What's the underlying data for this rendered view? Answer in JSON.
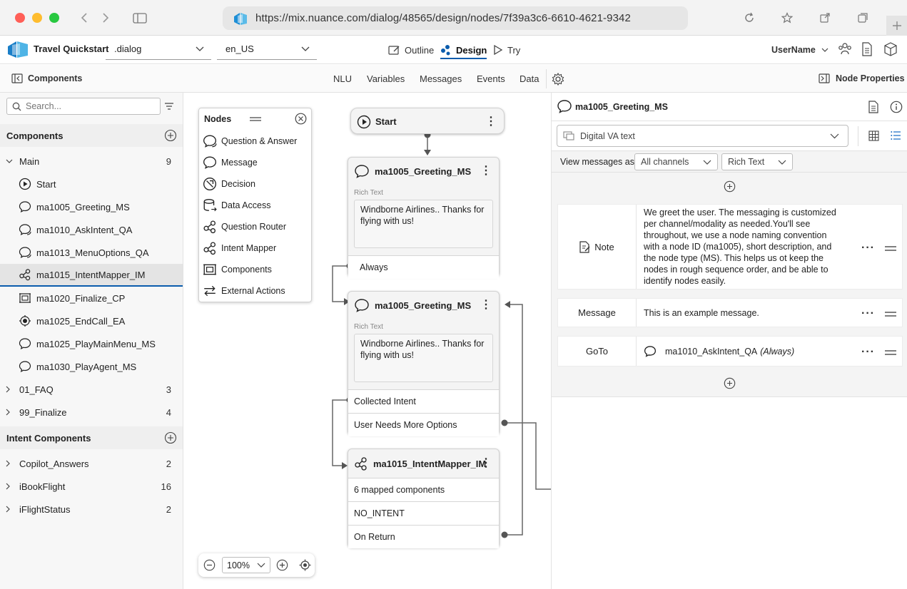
{
  "browser": {
    "url": "https://mix.nuance.com/dialog/48565/design/nodes/7f39a3c6-6610-4621-9342",
    "colors": {
      "close": "#ff5f57",
      "minimize": "#febc2e",
      "maximize": "#28c840"
    }
  },
  "app": {
    "title": "Travel Quickstart",
    "dialog_select": ".dialog",
    "locale_select": "en_US",
    "tabs": [
      {
        "label": "Outline",
        "icon": "outline-icon"
      },
      {
        "label": "Design",
        "icon": "design-icon",
        "active": true
      },
      {
        "label": "Try",
        "icon": "play-icon"
      }
    ],
    "user": "UserName",
    "accent": "#0b5cad"
  },
  "toolbar": {
    "components_label": "Components",
    "tabs": [
      "NLU",
      "Variables",
      "Messages",
      "Events",
      "Data"
    ],
    "node_properties_label": "Node Properties"
  },
  "sidebar": {
    "search_placeholder": "Search...",
    "components_header": "Components",
    "main": {
      "label": "Main",
      "count": "9"
    },
    "main_items": [
      {
        "label": "Start",
        "icon": "start-icon"
      },
      {
        "label": "ma1005_Greeting_MS",
        "icon": "message-icon"
      },
      {
        "label": "ma1010_AskIntent_QA",
        "icon": "question-icon"
      },
      {
        "label": "ma1013_MenuOptions_QA",
        "icon": "question-icon"
      },
      {
        "label": "ma1015_IntentMapper_IM",
        "icon": "intent-mapper-icon",
        "selected": true
      },
      {
        "label": "ma1020_Finalize_CP",
        "icon": "component-icon"
      },
      {
        "label": "ma1025_EndCall_EA",
        "icon": "external-action-icon"
      },
      {
        "label": "ma1025_PlayMainMenu_MS",
        "icon": "message-icon"
      },
      {
        "label": "ma1030_PlayAgent_MS",
        "icon": "message-icon"
      }
    ],
    "groups": [
      {
        "label": "01_FAQ",
        "count": "3"
      },
      {
        "label": "99_Finalize",
        "count": "4"
      }
    ],
    "intent_header": "Intent Components",
    "intent_groups": [
      {
        "label": "Copilot_Answers",
        "count": "2"
      },
      {
        "label": "iBookFlight",
        "count": "16"
      },
      {
        "label": "iFlightStatus",
        "count": "2"
      }
    ]
  },
  "palette": {
    "title": "Nodes",
    "items": [
      {
        "label": "Question & Answer",
        "icon": "question-answer-icon"
      },
      {
        "label": "Message",
        "icon": "message-icon"
      },
      {
        "label": "Decision",
        "icon": "decision-icon"
      },
      {
        "label": "Data Access",
        "icon": "data-access-icon"
      },
      {
        "label": "Question Router",
        "icon": "question-router-icon"
      },
      {
        "label": "Intent Mapper",
        "icon": "intent-mapper-icon"
      },
      {
        "label": "Components",
        "icon": "component-icon"
      },
      {
        "label": "External Actions",
        "icon": "external-action-icon"
      }
    ]
  },
  "canvas": {
    "start_label": "Start",
    "node1": {
      "title": "ma1005_Greeting_MS",
      "rt_label": "Rich Text",
      "text": "Windborne Airlines.. Thanks for flying with us!",
      "rows": [
        "Always"
      ]
    },
    "node2": {
      "title": "ma1005_Greeting_MS",
      "rt_label": "Rich Text",
      "text": "Windborne Airlines.. Thanks for flying with us!",
      "rows": [
        "Collected Intent",
        "User Needs More Options"
      ]
    },
    "node3": {
      "title": "ma1015_IntentMapper_IM",
      "rows": [
        "6 mapped components",
        "NO_INTENT",
        "On Return"
      ]
    },
    "zoom": "100%"
  },
  "properties": {
    "title": "ma1005_Greeting_MS",
    "channel": "Digital VA text",
    "view_as_label": "View messages as:",
    "channels_select": "All channels",
    "format_select": "Rich Text",
    "note_label": "Note",
    "note_text": "We greet the user. The messaging is customized per channel/modality as needed.You'll see throughout, we use a node naming convention with a node ID (ma1005), short description, and the node type (MS). This helps us ot keep the nodes in rough sequence order, and be able to identify nodes easily.",
    "message_label": "Message",
    "message_text": "This is an example message.",
    "goto_label": "GoTo",
    "goto_target": "ma1010_AskIntent_QA",
    "goto_condition": "(Always)"
  }
}
